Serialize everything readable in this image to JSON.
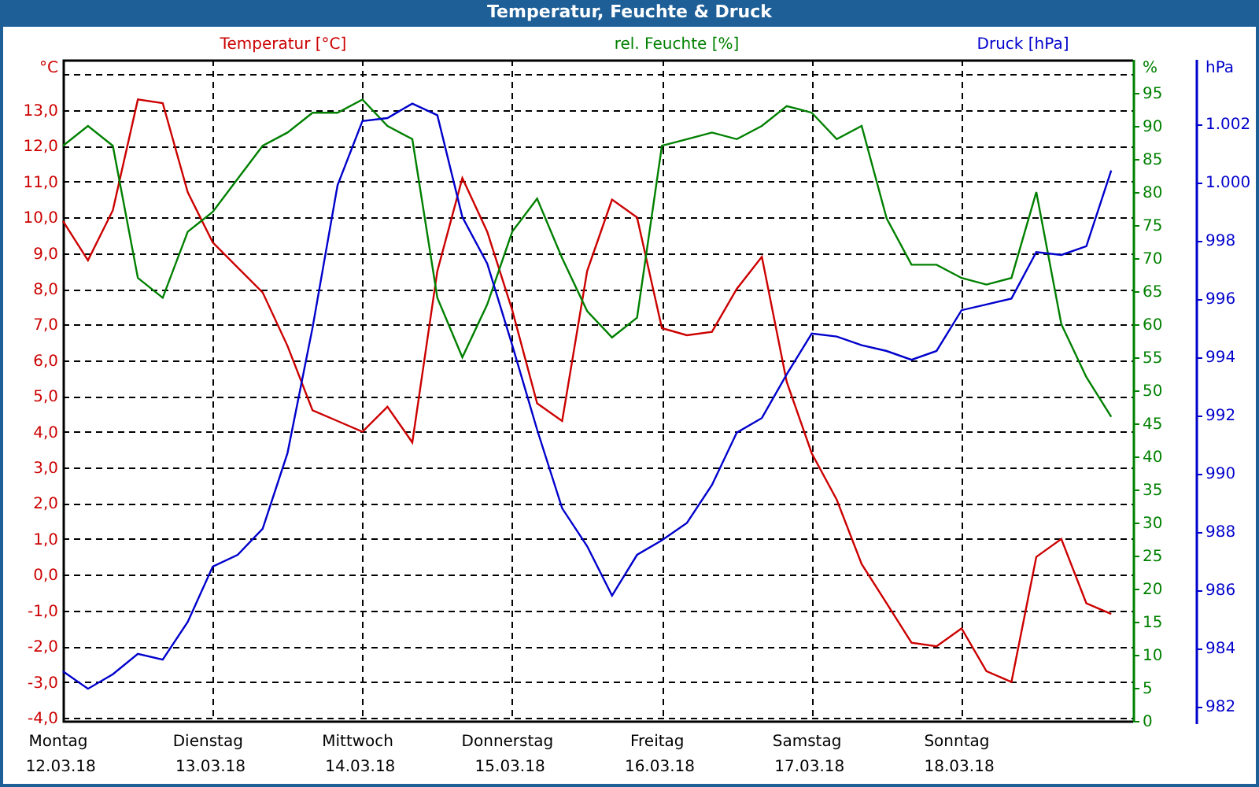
{
  "window": {
    "title": "Temperatur, Feuchte & Druck"
  },
  "chart_data": {
    "type": "line",
    "grid": true,
    "categories": [
      "Montag 12.03.18",
      null,
      null,
      null,
      null,
      null,
      "Dienstag 13.03.18",
      null,
      null,
      null,
      null,
      null,
      "Mittwoch 14.03.18",
      null,
      null,
      null,
      null,
      null,
      "Donnerstag 15.03.18",
      null,
      null,
      null,
      null,
      null,
      "Freitag 16.03.18",
      null,
      null,
      null,
      null,
      null,
      "Samstag 17.03.18",
      null,
      null,
      null,
      null,
      null,
      "Sonntag 18.03.18",
      null,
      null,
      null,
      null,
      null,
      null
    ],
    "ylabel": "°C",
    "ylim": [
      -4.09,
      14.41
    ],
    "yticks": [
      {
        "value": -4,
        "label": "-4,0"
      },
      {
        "value": -3,
        "label": "-3,0"
      },
      {
        "value": -2,
        "label": "-2,0"
      },
      {
        "value": -1,
        "label": "-1,0"
      },
      {
        "value": 0,
        "label": "0,0"
      },
      {
        "value": 1,
        "label": "1,0"
      },
      {
        "value": 2,
        "label": "2,0"
      },
      {
        "value": 3,
        "label": "3,0"
      },
      {
        "value": 4,
        "label": "4,0"
      },
      {
        "value": 5,
        "label": "5,0"
      },
      {
        "value": 6,
        "label": "6,0"
      },
      {
        "value": 7,
        "label": "7,0"
      },
      {
        "value": 8,
        "label": "8,0"
      },
      {
        "value": 9,
        "label": "9,0"
      },
      {
        "value": 10,
        "label": "10,0"
      },
      {
        "value": 11,
        "label": "11,0"
      },
      {
        "value": 12,
        "label": "12,0"
      },
      {
        "value": 13,
        "label": "13,0"
      }
    ],
    "y2label": "%",
    "y2lim": [
      0,
      100
    ],
    "y2ticks": [
      {
        "value": 0,
        "label": "0"
      },
      {
        "value": 5,
        "label": "5"
      },
      {
        "value": 10,
        "label": "10"
      },
      {
        "value": 15,
        "label": "15"
      },
      {
        "value": 20,
        "label": "20"
      },
      {
        "value": 25,
        "label": "25"
      },
      {
        "value": 30,
        "label": "30"
      },
      {
        "value": 35,
        "label": "35"
      },
      {
        "value": 40,
        "label": "40"
      },
      {
        "value": 45,
        "label": "45"
      },
      {
        "value": 50,
        "label": "50"
      },
      {
        "value": 55,
        "label": "55"
      },
      {
        "value": 60,
        "label": "60"
      },
      {
        "value": 65,
        "label": "65"
      },
      {
        "value": 70,
        "label": "70"
      },
      {
        "value": 75,
        "label": "75"
      },
      {
        "value": 80,
        "label": "80"
      },
      {
        "value": 85,
        "label": "85"
      },
      {
        "value": 90,
        "label": "90"
      },
      {
        "value": 95,
        "label": "95"
      }
    ],
    "y3label": "hPa",
    "y3lim": [
      981.5,
      1004.2
    ],
    "y3ticks": [
      {
        "value": 982,
        "label": "982"
      },
      {
        "value": 984,
        "label": "984"
      },
      {
        "value": 986,
        "label": "986"
      },
      {
        "value": 988,
        "label": "988"
      },
      {
        "value": 990,
        "label": "990"
      },
      {
        "value": 992,
        "label": "992"
      },
      {
        "value": 994,
        "label": "994"
      },
      {
        "value": 996,
        "label": "996"
      },
      {
        "value": 998,
        "label": "998"
      },
      {
        "value": 1000,
        "label": "1.000"
      },
      {
        "value": 1002,
        "label": "1.002"
      }
    ],
    "series": [
      {
        "name": "Temperatur [°C]",
        "color": "#cc0000",
        "values": [
          9.9,
          8.8,
          10.2,
          13.3,
          13.2,
          10.7,
          9.3,
          8.6,
          7.9,
          6.4,
          4.6,
          4.3,
          4.0,
          4.7,
          3.7,
          8.5,
          11.1,
          9.6,
          7.4,
          4.8,
          4.3,
          8.5,
          10.5,
          10.0,
          6.9,
          6.7,
          6.8,
          8.0,
          8.9,
          5.4,
          3.4,
          2.1,
          0.3,
          -0.8,
          -1.9,
          -2.0,
          -1.5,
          -2.7,
          -3.0,
          0.5,
          1.0,
          -0.8,
          -1.1
        ]
      },
      {
        "name": "rel. Feuchte [%]",
        "axis": "y2",
        "color": "#008000",
        "values": [
          87,
          90,
          87,
          67,
          64,
          74,
          77,
          82,
          87,
          89,
          92,
          92,
          94,
          90,
          88,
          64,
          55,
          63,
          74,
          79,
          70,
          62,
          58,
          61,
          87,
          88,
          89,
          88,
          90,
          93,
          92,
          88,
          90,
          76,
          69,
          69,
          67,
          66,
          67,
          80,
          60,
          52,
          46
        ]
      },
      {
        "name": "Druck [hPa]",
        "axis": "y3",
        "color": "#0000cc",
        "values": [
          983.2,
          982.6,
          983.1,
          983.8,
          983.6,
          984.9,
          986.8,
          987.2,
          988.1,
          990.7,
          995.0,
          999.9,
          1002.1,
          1002.2,
          1002.7,
          1002.3,
          998.8,
          997.2,
          994.4,
          991.5,
          988.8,
          987.5,
          985.8,
          987.2,
          987.7,
          988.3,
          989.6,
          991.4,
          991.9,
          993.4,
          994.8,
          994.7,
          994.4,
          994.2,
          993.9,
          994.2,
          995.6,
          995.8,
          996.0,
          997.6,
          997.5,
          997.8,
          1000.4
        ]
      }
    ]
  }
}
